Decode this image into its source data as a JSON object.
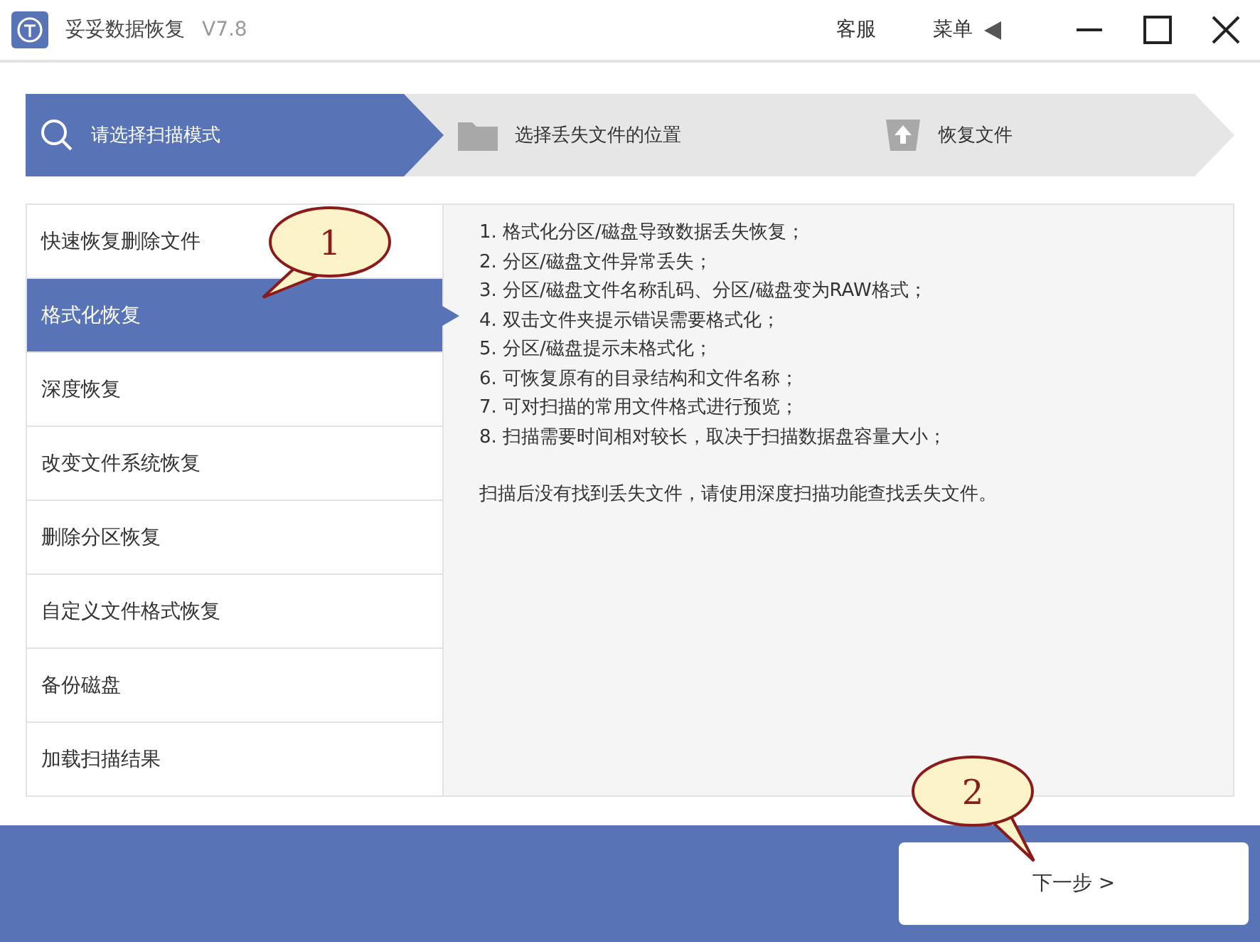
{
  "window": {
    "title": "妥妥数据恢复",
    "version": "V7.8",
    "support": "客服",
    "menu": "菜单"
  },
  "steps": [
    {
      "label": "请选择扫描模式",
      "selected": true
    },
    {
      "label": "选择丢失文件的位置",
      "selected": false
    },
    {
      "label": "恢复文件",
      "selected": false
    }
  ],
  "modes": [
    {
      "label": "快速恢复删除文件",
      "selected": false
    },
    {
      "label": "格式化恢复",
      "selected": true
    },
    {
      "label": "深度恢复",
      "selected": false
    },
    {
      "label": "改变文件系统恢复",
      "selected": false
    },
    {
      "label": "删除分区恢复",
      "selected": false
    },
    {
      "label": "自定义文件格式恢复",
      "selected": false
    },
    {
      "label": "备份磁盘",
      "selected": false
    },
    {
      "label": "加载扫描结果",
      "selected": false
    }
  ],
  "description": {
    "lines": [
      "1. 格式化分区/磁盘导致数据丢失恢复；",
      "2. 分区/磁盘文件异常丢失；",
      "3. 分区/磁盘文件名称乱码、分区/磁盘变为RAW格式；",
      "4. 双击文件夹提示错误需要格式化；",
      "5. 分区/磁盘提示未格式化；",
      "6. 可恢复原有的目录结构和文件名称；",
      "7. 可对扫描的常用文件格式进行预览；",
      "8. 扫描需要时间相对较长，取决于扫描数据盘容量大小；"
    ],
    "note": "扫描后没有找到丢失文件，请使用深度扫描功能查找丢失文件。"
  },
  "footer": {
    "next_button": "下一步 >"
  },
  "callouts": [
    {
      "label": "1"
    },
    {
      "label": "2"
    }
  ]
}
